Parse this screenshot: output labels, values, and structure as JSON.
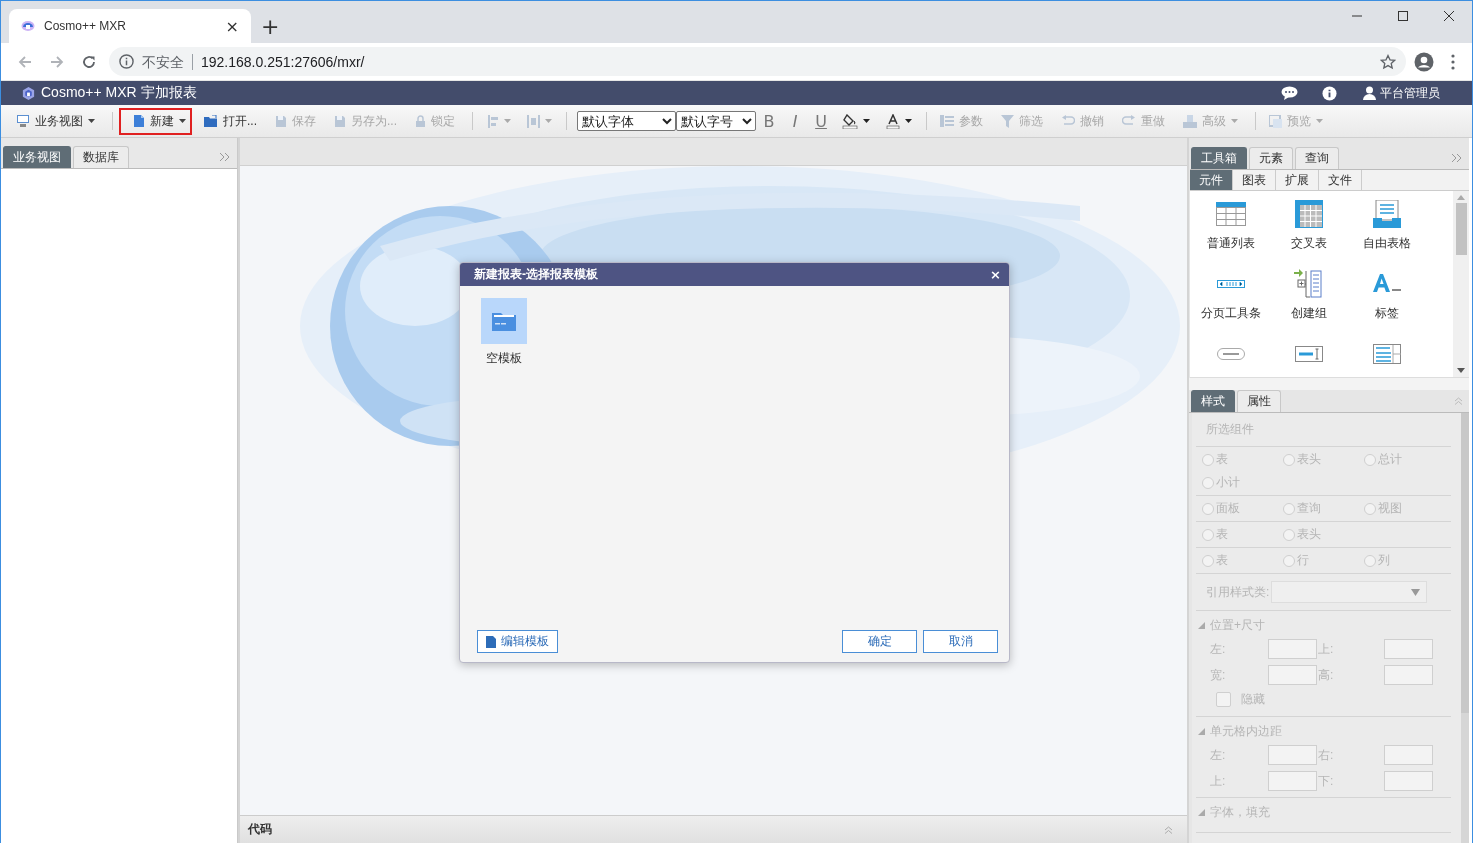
{
  "browser": {
    "tab": {
      "title": "Cosmo++ MXR",
      "close": "×"
    },
    "new_tab": "+",
    "security": "不安全",
    "url": "192.168.0.251:27606/mxr/"
  },
  "app": {
    "title": "Cosmo++ MXR 宇加报表",
    "user": "平台管理员"
  },
  "toolbar": [
    {
      "kind": "button",
      "label": "业务视图",
      "caret": true,
      "disabled": false,
      "highlighted": false
    },
    {
      "kind": "sep"
    },
    {
      "kind": "button",
      "label": "新建",
      "caret": true,
      "disabled": false,
      "highlighted": true
    },
    {
      "kind": "button",
      "label": "打开...",
      "caret": false,
      "disabled": false,
      "highlighted": false
    },
    {
      "kind": "button",
      "label": "保存",
      "caret": false,
      "disabled": true,
      "highlighted": false
    },
    {
      "kind": "button",
      "label": "另存为...",
      "caret": false,
      "disabled": true,
      "highlighted": false
    },
    {
      "kind": "button",
      "label": "锁定",
      "caret": false,
      "disabled": true,
      "highlighted": false
    },
    {
      "kind": "sep"
    },
    {
      "kind": "icon-menu",
      "disabled": true
    },
    {
      "kind": "icon-menu",
      "disabled": true
    },
    {
      "kind": "sep"
    },
    {
      "kind": "select",
      "label": "默认字体"
    },
    {
      "kind": "select",
      "label": "默认字号"
    },
    {
      "kind": "bold",
      "label": "B"
    },
    {
      "kind": "italic",
      "label": "I"
    },
    {
      "kind": "underline",
      "label": "U"
    },
    {
      "kind": "color-menu"
    },
    {
      "kind": "color-menu"
    },
    {
      "kind": "sep"
    },
    {
      "kind": "button",
      "label": "参数",
      "caret": false,
      "disabled": true,
      "highlighted": false
    },
    {
      "kind": "button",
      "label": "筛选",
      "caret": false,
      "disabled": true,
      "highlighted": false
    },
    {
      "kind": "button",
      "label": "撤销",
      "caret": false,
      "disabled": true,
      "highlighted": false
    },
    {
      "kind": "button",
      "label": "重做",
      "caret": false,
      "disabled": true,
      "highlighted": false
    },
    {
      "kind": "button",
      "label": "高级",
      "caret": true,
      "disabled": true,
      "highlighted": false
    },
    {
      "kind": "sep"
    },
    {
      "kind": "button",
      "label": "预览",
      "caret": true,
      "disabled": true,
      "highlighted": false
    }
  ],
  "left_panel": {
    "tabs": [
      {
        "label": "业务视图",
        "selected": true
      },
      {
        "label": "数据库",
        "selected": false
      }
    ]
  },
  "toolbox": {
    "tabs": [
      {
        "label": "工具箱",
        "selected": true
      },
      {
        "label": "元素",
        "selected": false
      },
      {
        "label": "查询",
        "selected": false
      }
    ],
    "subtabs": [
      {
        "label": "元件",
        "selected": true
      },
      {
        "label": "图表",
        "selected": false
      },
      {
        "label": "扩展",
        "selected": false
      },
      {
        "label": "文件",
        "selected": false
      }
    ],
    "items": [
      {
        "label": "普通列表"
      },
      {
        "label": "交叉表"
      },
      {
        "label": "自由表格"
      },
      {
        "label": "分页工具条"
      },
      {
        "label": "创建组"
      },
      {
        "label": "标签"
      }
    ]
  },
  "style_panel": {
    "tabs": [
      {
        "label": "样式",
        "selected": true
      },
      {
        "label": "属性",
        "selected": false
      }
    ],
    "disabled": true,
    "selected_component": "所选组件",
    "radio_groups": [
      [
        {
          "label": "表",
          "checked": false
        },
        {
          "label": "表头",
          "checked": false
        },
        {
          "label": "总计",
          "checked": false
        },
        {
          "label": "小计",
          "checked": false
        }
      ],
      [
        {
          "label": "面板",
          "checked": false
        },
        {
          "label": "查询",
          "checked": false
        },
        {
          "label": "视图",
          "checked": false
        }
      ],
      [
        {
          "label": "表",
          "checked": false
        },
        {
          "label": "表头",
          "checked": false
        }
      ],
      [
        {
          "label": "表",
          "checked": false
        },
        {
          "label": "行",
          "checked": false
        },
        {
          "label": "列",
          "checked": false
        }
      ]
    ],
    "style_class_label": "引用样式类:",
    "sections": [
      {
        "title": "位置+尺寸",
        "expanded": true,
        "fields": [
          {
            "label": "左:"
          },
          {
            "label": "上:"
          },
          {
            "label": "宽:"
          },
          {
            "label": "高:"
          }
        ],
        "checkbox": {
          "label": "隐藏",
          "checked": false
        }
      },
      {
        "title": "单元格内边距",
        "expanded": true,
        "fields": [
          {
            "label": "左:"
          },
          {
            "label": "右:"
          },
          {
            "label": "上:"
          },
          {
            "label": "下:"
          }
        ]
      },
      {
        "title": "字体，填充",
        "expanded": true
      }
    ]
  },
  "code_panel": {
    "title": "代码"
  },
  "dialog": {
    "title": "新建报表-选择报表模板",
    "close": "×",
    "templates": [
      {
        "label": "空模板",
        "selected": true
      }
    ],
    "buttons": [
      {
        "label": "编辑模板",
        "kind": "edit"
      },
      {
        "label": "确定",
        "kind": "plain"
      },
      {
        "label": "取消",
        "kind": "plain"
      }
    ]
  }
}
